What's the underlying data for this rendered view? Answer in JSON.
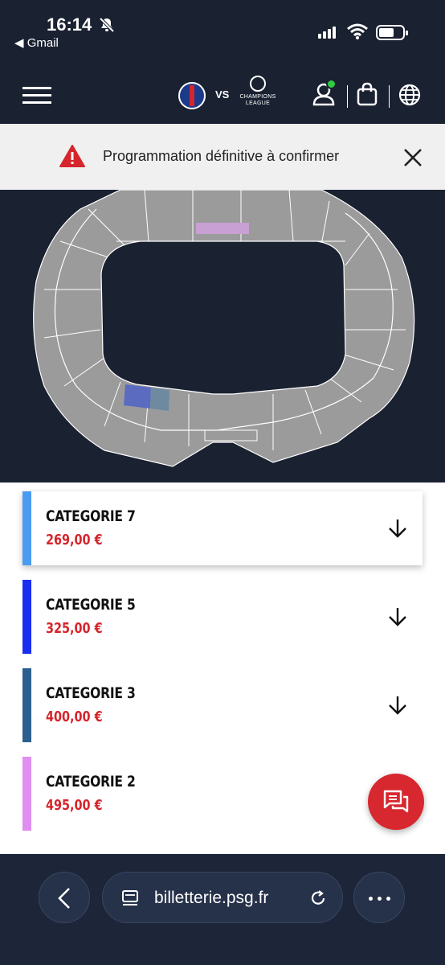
{
  "status_bar": {
    "time": "16:14",
    "back_app": "◀ Gmail"
  },
  "header": {
    "vs_label": "VS",
    "ucl_text": "CHAMPIONS LEAGUE",
    "accent": "#2ecc40"
  },
  "notice": {
    "text": "Programmation définitive à confirmer",
    "icon": "warning-icon",
    "color": "#d6252c"
  },
  "categories": [
    {
      "name": "CATEGORIE 7",
      "price": "269,00 €",
      "color": "#4a9cf0"
    },
    {
      "name": "CATEGORIE 5",
      "price": "325,00 €",
      "color": "#1a2ef0"
    },
    {
      "name": "CATEGORIE 3",
      "price": "400,00 €",
      "color": "#2c5f8f"
    },
    {
      "name": "CATEGORIE 2",
      "price": "495,00 €",
      "color": "#e08ef0"
    }
  ],
  "browser": {
    "url": "billetterie.psg.fr"
  }
}
